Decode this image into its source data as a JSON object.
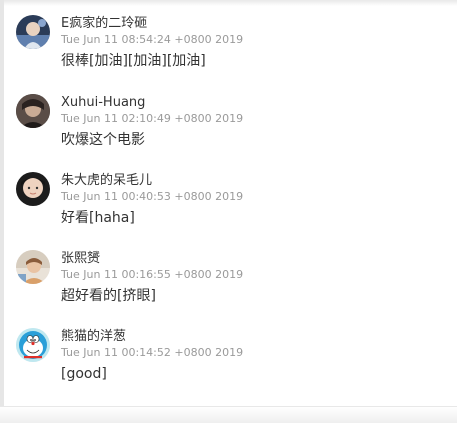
{
  "comments": [
    {
      "avatar_icon": "avatar-photo-icon",
      "username": "E疯家的二玲砸",
      "time": "Tue Jun 11 08:54:24 +0800 2019",
      "text": "很棒[加油][加油][加油]"
    },
    {
      "avatar_icon": "avatar-photo-icon",
      "username": "Xuhui-Huang",
      "time": "Tue Jun 11 02:10:49 +0800 2019",
      "text": "吹爆这个电影"
    },
    {
      "avatar_icon": "avatar-photo-icon",
      "username": "朱大虎的呆毛儿",
      "time": "Tue Jun 11 00:40:53 +0800 2019",
      "text": "好看[haha]"
    },
    {
      "avatar_icon": "avatar-photo-icon",
      "username": "张熙赟",
      "time": "Tue Jun 11 00:16:55 +0800 2019",
      "text": "超好看的[挤眼]"
    },
    {
      "avatar_icon": "avatar-doraemon-icon",
      "username": "熊猫的洋葱",
      "time": "Tue Jun 11 00:14:52 +0800 2019",
      "text": "[good]"
    }
  ],
  "colors": {
    "username": "#333333",
    "timestamp": "#9a9a9a",
    "text": "#333333"
  }
}
